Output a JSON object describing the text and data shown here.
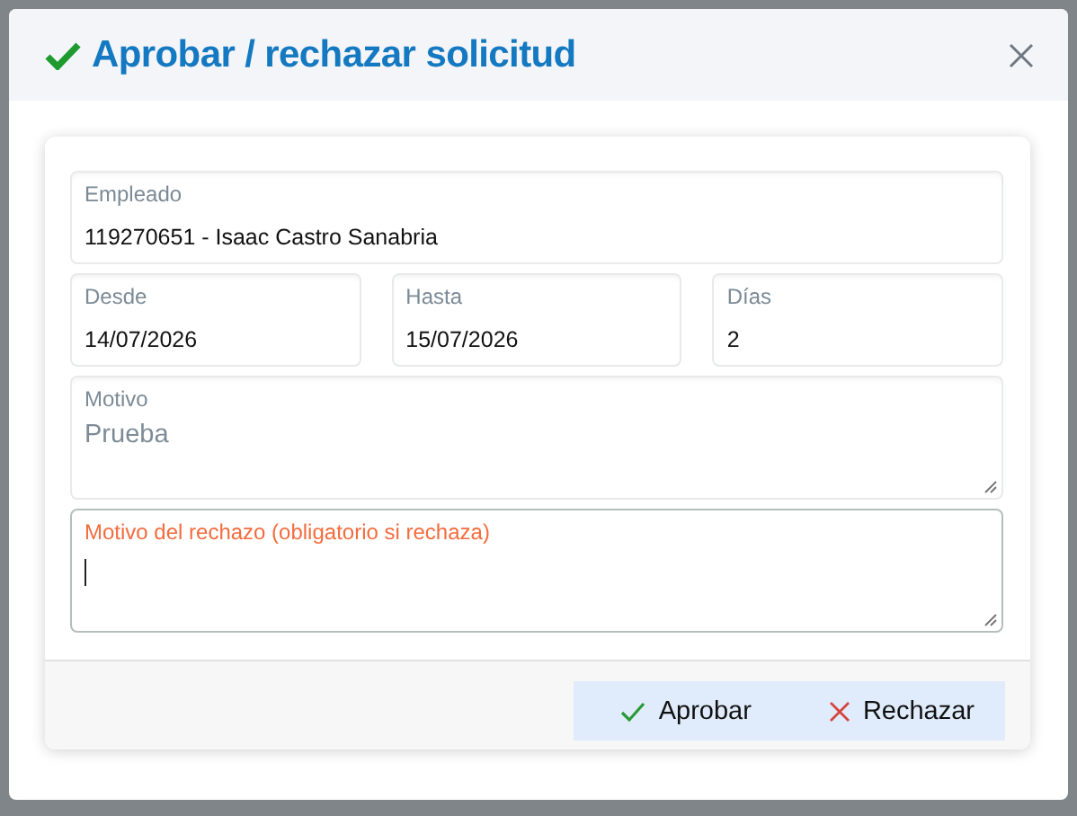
{
  "dialog": {
    "title": "Aprobar / rechazar solicitud"
  },
  "fields": [
    {
      "label": "Empleado",
      "value": "119270651 - Isaac Castro Sanabria",
      "kind": "input",
      "focused": false
    },
    {
      "label": "Desde",
      "value": "14/07/2026",
      "kind": "input",
      "focused": false
    },
    {
      "label": "Hasta",
      "value": "15/07/2026",
      "kind": "input",
      "focused": false
    },
    {
      "label": "Días",
      "value": "2",
      "kind": "input",
      "focused": false
    },
    {
      "label": "Motivo",
      "placeholder": "Prueba",
      "kind": "textarea",
      "focused": false
    },
    {
      "label": "Motivo del rechazo (obligatorio si rechaza)",
      "kind": "textarea",
      "focused": true
    }
  ],
  "buttons": [
    {
      "label": "Aprobar",
      "kind": "approve"
    },
    {
      "label": "Rechazar",
      "kind": "reject"
    }
  ]
}
